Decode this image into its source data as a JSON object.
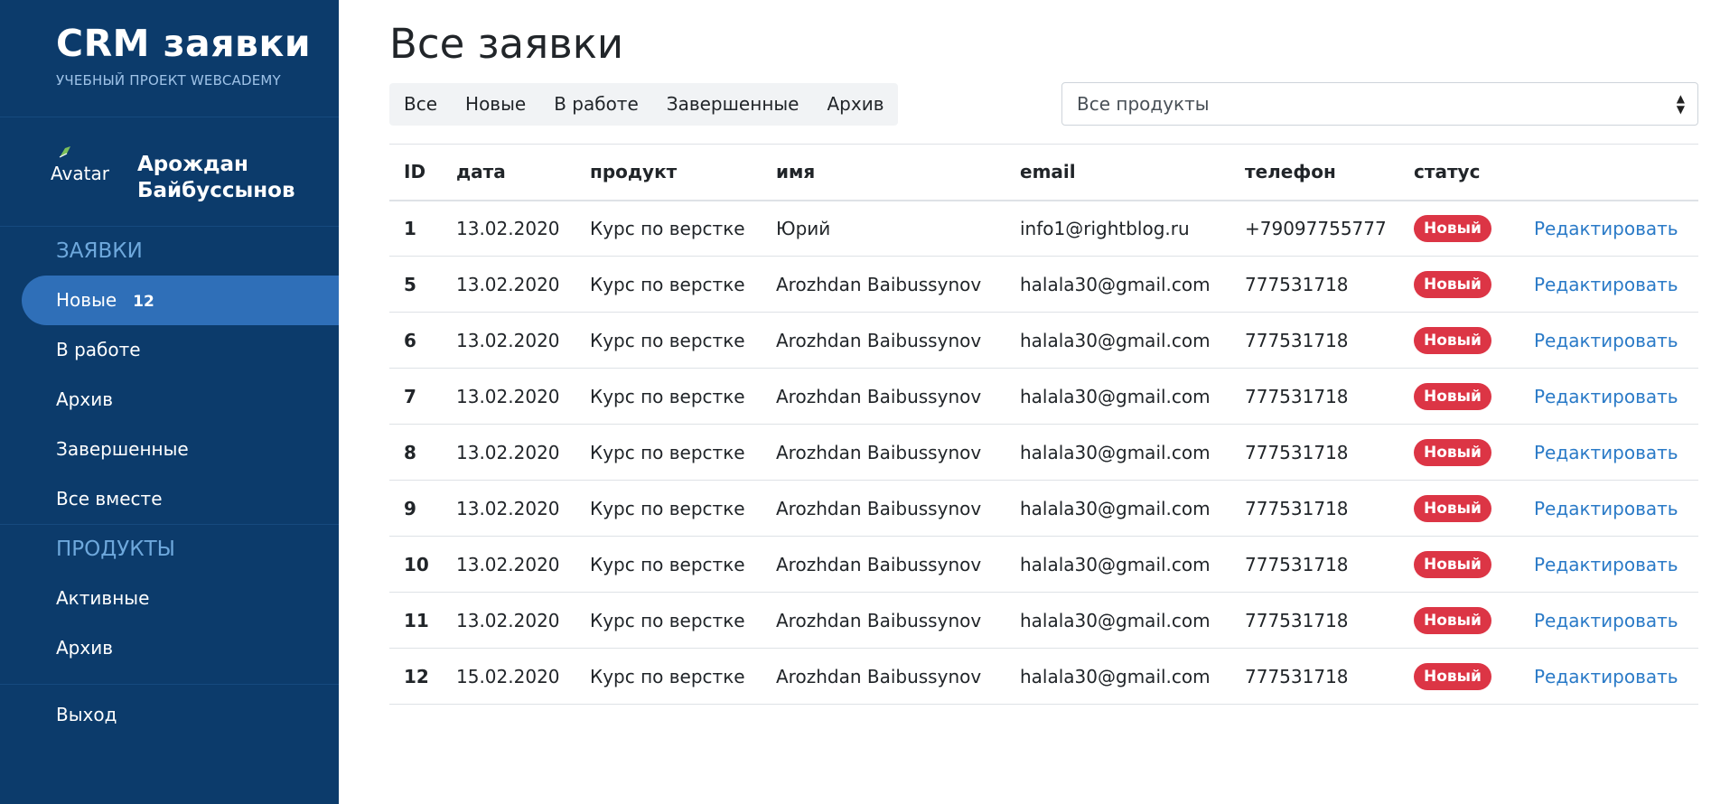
{
  "sidebar": {
    "brand_title": "CRM заявки",
    "brand_subtitle": "УЧЕБНЫЙ ПРОЕКТ WEBCADEMY",
    "avatar_alt": "Avatar",
    "user_name": "Арождан Байбуссынов",
    "sections": [
      {
        "title": "ЗАЯВКИ",
        "items": [
          {
            "label": "Новые",
            "count": "12",
            "active": true
          },
          {
            "label": "В работе"
          },
          {
            "label": "Архив"
          },
          {
            "label": "Завершенные"
          },
          {
            "label": "Все вместе"
          }
        ]
      },
      {
        "title": "ПРОДУКТЫ",
        "items": [
          {
            "label": "Активные"
          },
          {
            "label": "Архив"
          }
        ]
      }
    ],
    "logout_label": "Выход"
  },
  "main": {
    "title": "Все заявки",
    "filters": [
      "Все",
      "Новые",
      "В работе",
      "Завершенные",
      "Архив"
    ],
    "product_select": {
      "selected": "Все продукты"
    },
    "table": {
      "columns": [
        "ID",
        "дата",
        "продукт",
        "имя",
        "email",
        "телефон",
        "статус"
      ],
      "rows": [
        {
          "id": "1",
          "date": "13.02.2020",
          "product": "Курс по верстке",
          "name": "Юрий",
          "email": "info1@rightblog.ru",
          "phone": "+79097755777",
          "status": "Новый",
          "action": "Редактировать"
        },
        {
          "id": "5",
          "date": "13.02.2020",
          "product": "Курс по верстке",
          "name": "Arozhdan Baibussynov",
          "email": "halala30@gmail.com",
          "phone": "777531718",
          "status": "Новый",
          "action": "Редактировать"
        },
        {
          "id": "6",
          "date": "13.02.2020",
          "product": "Курс по верстке",
          "name": "Arozhdan Baibussynov",
          "email": "halala30@gmail.com",
          "phone": "777531718",
          "status": "Новый",
          "action": "Редактировать"
        },
        {
          "id": "7",
          "date": "13.02.2020",
          "product": "Курс по верстке",
          "name": "Arozhdan Baibussynov",
          "email": "halala30@gmail.com",
          "phone": "777531718",
          "status": "Новый",
          "action": "Редактировать"
        },
        {
          "id": "8",
          "date": "13.02.2020",
          "product": "Курс по верстке",
          "name": "Arozhdan Baibussynov",
          "email": "halala30@gmail.com",
          "phone": "777531718",
          "status": "Новый",
          "action": "Редактировать"
        },
        {
          "id": "9",
          "date": "13.02.2020",
          "product": "Курс по верстке",
          "name": "Arozhdan Baibussynov",
          "email": "halala30@gmail.com",
          "phone": "777531718",
          "status": "Новый",
          "action": "Редактировать"
        },
        {
          "id": "10",
          "date": "13.02.2020",
          "product": "Курс по верстке",
          "name": "Arozhdan Baibussynov",
          "email": "halala30@gmail.com",
          "phone": "777531718",
          "status": "Новый",
          "action": "Редактировать"
        },
        {
          "id": "11",
          "date": "13.02.2020",
          "product": "Курс по верстке",
          "name": "Arozhdan Baibussynov",
          "email": "halala30@gmail.com",
          "phone": "777531718",
          "status": "Новый",
          "action": "Редактировать"
        },
        {
          "id": "12",
          "date": "15.02.2020",
          "product": "Курс по верстке",
          "name": "Arozhdan Baibussynov",
          "email": "halala30@gmail.com",
          "phone": "777531718",
          "status": "Новый",
          "action": "Редактировать"
        }
      ]
    }
  },
  "colors": {
    "sidebar_bg": "#0c3b6b",
    "active_item_bg": "#2f6fb8",
    "badge_new": "#dc3545",
    "link": "#2a7ac7"
  },
  "icons": {
    "avatar": "broken-image-icon",
    "select_arrow": "sort-arrows-icon"
  }
}
